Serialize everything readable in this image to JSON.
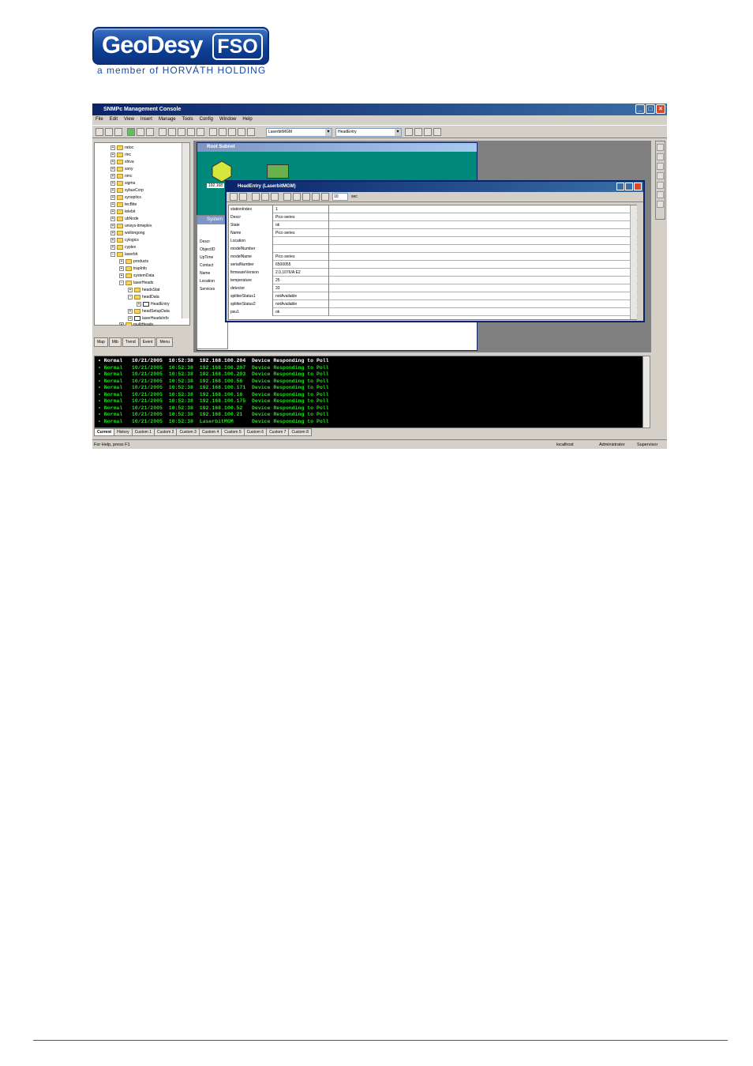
{
  "logo": {
    "brand": "GeoDesy",
    "badge": "FSO",
    "tagline": "a member of HORVÁTH HOLDING"
  },
  "app": {
    "title": "SNMPc Management Console",
    "menu": [
      "File",
      "Edit",
      "View",
      "Insert",
      "Manage",
      "Tools",
      "Config",
      "Window",
      "Help"
    ],
    "combo_map": "LaserbitMGM",
    "combo_table": "HeadEntry"
  },
  "tree": {
    "items": [
      "ratoc",
      "rinc",
      "shiva",
      "sony",
      "nmc",
      "sigma",
      "sybusCorp",
      "synoptics",
      "tecBite",
      "telebit",
      "ubNode",
      "unisys-itmeplex",
      "wollongong",
      "cylogics",
      "cyplex",
      "laserbit",
      "products",
      "trapInfo",
      "systemData",
      "laserHeads",
      "headsStat",
      "headData",
      "HeadEntry",
      "headSetupData",
      "laserHeadsInfo",
      "multiHeads"
    ],
    "tabs": [
      "Map",
      "Mib",
      "Trend",
      "Event",
      "Menu"
    ]
  },
  "root_window": {
    "title": "Root Subnet",
    "node_label": "192.168"
  },
  "system_window": {
    "title": "System",
    "labels": [
      "Descr",
      "ObjectID",
      "UpTime",
      "Contact",
      "Name",
      "Location",
      "Services"
    ]
  },
  "head_window": {
    "title": "HeadEntry (LaserbitMGM)",
    "poll_value": "10",
    "poll_unit": "sec",
    "rows": [
      {
        "k": "stationIndex",
        "v": "1"
      },
      {
        "k": "Descr",
        "v": "Pico series"
      },
      {
        "k": "State",
        "v": "ok"
      },
      {
        "k": "Name",
        "v": "Pico series"
      },
      {
        "k": "Location",
        "v": ""
      },
      {
        "k": "modelNumber",
        "v": ""
      },
      {
        "k": "modelName",
        "v": "Pico series"
      },
      {
        "k": "serialNumber",
        "v": "6500055"
      },
      {
        "k": "firmwareVersion",
        "v": "2.0.1076/A:E2"
      },
      {
        "k": "temperature",
        "v": "25"
      },
      {
        "k": "detector",
        "v": "33"
      },
      {
        "k": "splitterStatus1",
        "v": "notAvailable"
      },
      {
        "k": "splitterStatus2",
        "v": "notAvailable"
      },
      {
        "k": "psu1",
        "v": "ok"
      }
    ]
  },
  "event_log": {
    "rows": [
      {
        "t": "• Normal   10/21/2005  10:52:38  192.168.100.204  Device Responding to Poll"
      },
      {
        "t": "• Normal   10/21/2005  10:52:38  192.168.100.207  Device Responding to Poll"
      },
      {
        "t": "• Normal   10/21/2005  10:52:38  192.168.100.203  Device Responding to Poll"
      },
      {
        "t": "• Normal   10/21/2005  10:52:38  192.168.100.56   Device Responding to Poll"
      },
      {
        "t": "• Normal   10/21/2005  10:52:38  192.168.100.171  Device Responding to Poll"
      },
      {
        "t": "• Normal   10/21/2005  10:52:38  192.168.100.16   Device Responding to Poll"
      },
      {
        "t": "• Normal   10/21/2005  10:52:38  192.168.100.175  Device Responding to Poll"
      },
      {
        "t": "• Normal   10/21/2005  10:52:38  192.168.100.52   Device Responding to Poll"
      },
      {
        "t": "• Normal   10/21/2005  10:52:38  192.168.100.21   Device Responding to Poll"
      },
      {
        "t": "• Normal   10/21/2005  10:52:38  LaserbitMGM      Device Responding to Poll"
      }
    ],
    "tabs": [
      "Current",
      "History",
      "Custom 1",
      "Custom 2",
      "Custom 3",
      "Custom 4",
      "Custom 5",
      "Custom 6",
      "Custom 7",
      "Custom 8"
    ]
  },
  "status": {
    "help": "For Help, press F1",
    "host": "localhost",
    "user": "Administrator",
    "role": "Supervisor"
  }
}
